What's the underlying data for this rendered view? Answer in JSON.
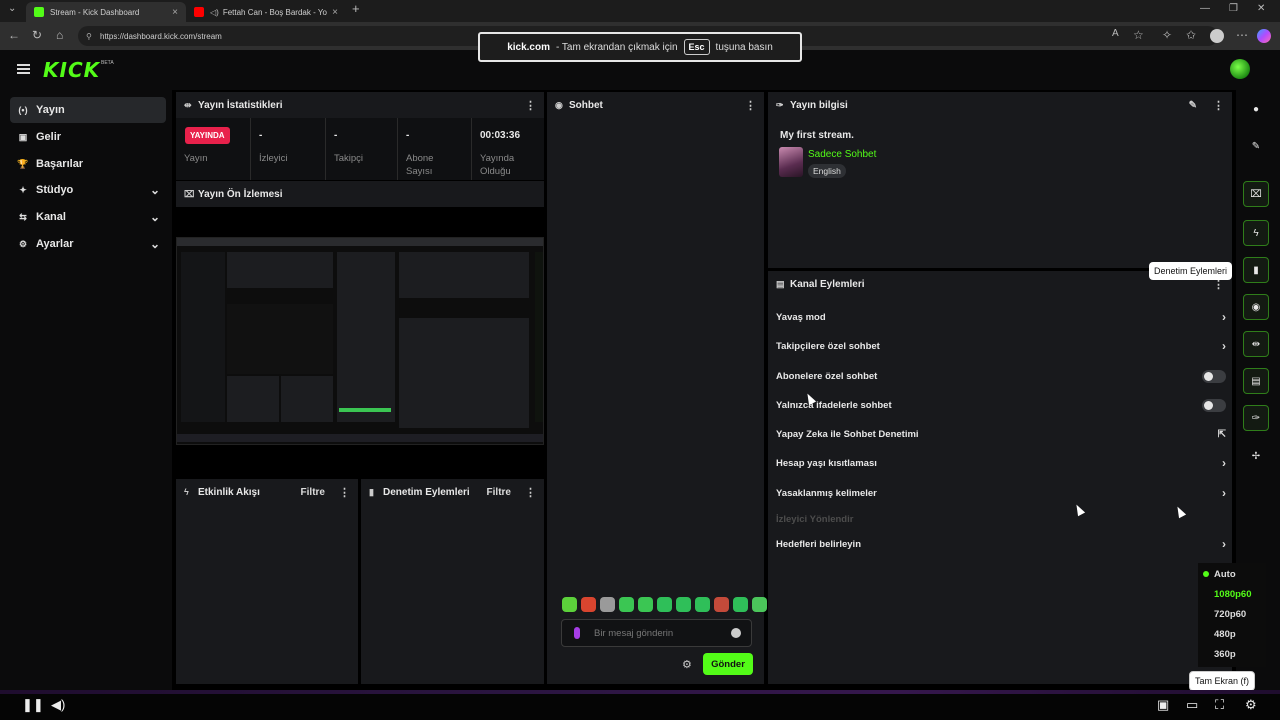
{
  "browser": {
    "tabs": [
      {
        "title": "Stream - Kick Dashboard",
        "active": true,
        "color": "#53fc18"
      },
      {
        "title": "Fettah Can - Boş Bardak - Yo",
        "active": false,
        "color": "#ff0000"
      }
    ],
    "url": "https://dashboard.kick.com/stream",
    "fullscreen_toast": {
      "site": "kick.com",
      "prefix": "- Tam ekrandan çıkmak için",
      "key": "Esc",
      "suffix": "tuşuna basın"
    }
  },
  "header": {
    "logo": "KICK",
    "logo_badge": "BETA"
  },
  "sidebar": {
    "items": [
      {
        "label": "Yayın",
        "icon": "broadcast-icon",
        "glyph": "(•)",
        "active": true,
        "expandable": false
      },
      {
        "label": "Gelir",
        "icon": "revenue-icon",
        "glyph": "▣",
        "active": false,
        "expandable": false
      },
      {
        "label": "Başarılar",
        "icon": "trophy-icon",
        "glyph": "🏆",
        "active": false,
        "expandable": false
      },
      {
        "label": "Stüdyo",
        "icon": "studio-icon",
        "glyph": "✦",
        "active": false,
        "expandable": true
      },
      {
        "label": "Kanal",
        "icon": "channel-icon",
        "glyph": "⇆",
        "active": false,
        "expandable": true
      },
      {
        "label": "Ayarlar",
        "icon": "settings-icon",
        "glyph": "⚙",
        "active": false,
        "expandable": true
      }
    ]
  },
  "stats_panel": {
    "title": "Yayın İstatistikleri",
    "live_badge": "YAYINDA",
    "cols": [
      {
        "value": "",
        "label": "Yayın"
      },
      {
        "value": "-",
        "label": "İzleyici"
      },
      {
        "value": "-",
        "label": "Takipçi"
      },
      {
        "value": "-",
        "label": "Abone Sayısı"
      },
      {
        "value": "00:03:36",
        "label": "Yayında Olduğu"
      }
    ]
  },
  "preview_panel": {
    "title": "Yayın Ön İzlemesi"
  },
  "activity_panel": {
    "title": "Etkinlik Akışı",
    "filter": "Filtre"
  },
  "mod_panel": {
    "title": "Denetim Eylemleri",
    "filter": "Filtre"
  },
  "chat_panel": {
    "title": "Sohbet",
    "placeholder": "Bir mesaj gönderin",
    "send": "Gönder",
    "emote_colors": [
      "#5cd13b",
      "#d9452f",
      "#9a9a9a",
      "#3bc653",
      "#3bc653",
      "#2fbf59",
      "#2fbf59",
      "#2fbf59",
      "#c44a3a",
      "#2fbf59",
      "#4bc65b"
    ]
  },
  "stream_info": {
    "title": "Yayın bilgisi",
    "stream_title": "My first stream.",
    "category": "Sadece Sohbet",
    "language": "English"
  },
  "channel_actions": {
    "title": "Kanal Eylemleri",
    "rows": [
      {
        "label": "Yavaş mod",
        "control": "chevron"
      },
      {
        "label": "Takipçilere özel sohbet",
        "control": "chevron"
      },
      {
        "label": "Abonelere özel sohbet",
        "control": "toggle"
      },
      {
        "label": "Yalnızca ifadelerle sohbet",
        "control": "toggle"
      },
      {
        "label": "Yapay Zeka ile Sohbet Denetimi",
        "control": "external"
      },
      {
        "label": "Hesap yaşı kısıtlaması",
        "control": "chevron"
      },
      {
        "label": "Yasaklanmış kelimeler",
        "control": "chevron"
      },
      {
        "label": "İzleyici Yönlendir",
        "control": "none",
        "disabled": true
      },
      {
        "label": "Hedefleri belirleyin",
        "control": "chevron"
      }
    ]
  },
  "right_rail": {
    "buttons": [
      {
        "name": "info-icon",
        "glyph": "●",
        "outlined": false
      },
      {
        "name": "edit-icon",
        "glyph": "✎",
        "outlined": false
      },
      {
        "name": "preview-icon",
        "glyph": "⌧",
        "outlined": true
      },
      {
        "name": "lightning-icon",
        "glyph": "ϟ",
        "outlined": true
      },
      {
        "name": "moderation-icon",
        "glyph": "▮",
        "outlined": true
      },
      {
        "name": "chat-icon",
        "glyph": "◉",
        "outlined": true
      },
      {
        "name": "stats-icon",
        "glyph": "⇹",
        "outlined": true
      },
      {
        "name": "channel-actions-icon",
        "glyph": "▤",
        "outlined": true
      },
      {
        "name": "wrench-icon",
        "glyph": "✑",
        "outlined": true
      },
      {
        "name": "more-icon",
        "glyph": "✢",
        "outlined": false
      }
    ],
    "tooltip": "Denetim Eylemleri"
  },
  "quality_menu": {
    "options": [
      "Auto",
      "1080p60",
      "720p60",
      "480p",
      "360p"
    ],
    "selected": "Auto",
    "highlighted": "1080p60"
  },
  "player": {
    "fullscreen_tooltip": "Tam Ekran (f)"
  }
}
